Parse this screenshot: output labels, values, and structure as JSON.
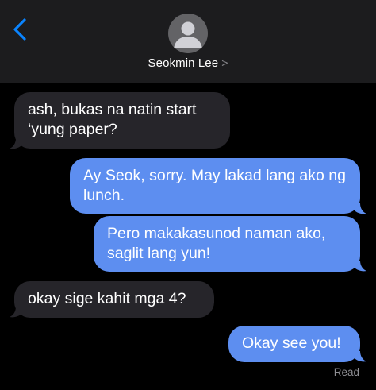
{
  "header": {
    "back_icon": "chevron-left-icon",
    "avatar_icon": "person-icon",
    "contact_name": "Seokmin Lee",
    "contact_chevron": ">"
  },
  "messages": [
    {
      "direction": "incoming",
      "text": "ash, bukas na natin start ‘yung paper?"
    },
    {
      "direction": "outgoing",
      "text": "Ay Seok, sorry. May lakad lang ako ng lunch."
    },
    {
      "direction": "outgoing",
      "text": "Pero makakasunod naman ako, saglit lang yun!"
    },
    {
      "direction": "incoming",
      "text": "okay sige kahit mga 4?"
    },
    {
      "direction": "outgoing",
      "text": "Okay see you!"
    }
  ],
  "status": {
    "read_label": "Read"
  },
  "colors": {
    "header_bg": "#1c1c1e",
    "incoming_bubble": "#26252a",
    "outgoing_bubble": "#5d8ef0",
    "accent": "#0a84ff",
    "status_text": "#8e8e93"
  }
}
